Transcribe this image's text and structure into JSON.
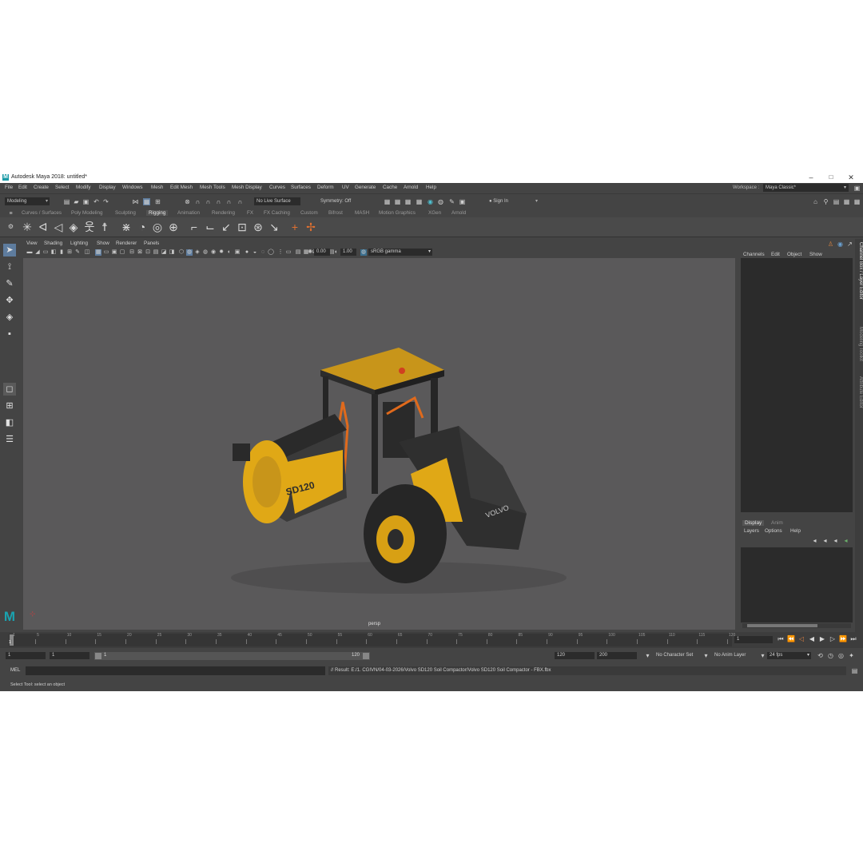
{
  "window": {
    "title": "Autodesk Maya 2018: untitled*",
    "logo": "M",
    "minimize": "–",
    "maximize": "□",
    "close": "✕"
  },
  "menubar": [
    "File",
    "Edit",
    "Create",
    "Select",
    "Modify",
    "Display",
    "Windows",
    "Mesh",
    "Edit Mesh",
    "Mesh Tools",
    "Mesh Display",
    "Curves",
    "Surfaces",
    "Deform",
    "UV",
    "Generate",
    "Cache",
    "Arnold",
    "Help"
  ],
  "workspace": {
    "label": "Workspace :",
    "value": "Maya Classic*"
  },
  "status_line": {
    "mode": "Modeling",
    "live_surface": "No Live Surface",
    "symmetry": "Symmetry: Off",
    "sign_in": "Sign In"
  },
  "shelf_tabs": [
    "Curves / Surfaces",
    "Poly Modeling",
    "Sculpting",
    "Rigging",
    "Animation",
    "Rendering",
    "FX",
    "FX Caching",
    "Custom",
    "Bifrost",
    "MASH",
    "Motion Graphics",
    "XGen",
    "Arnold"
  ],
  "active_shelf": "Rigging",
  "viewport": {
    "menu": [
      "View",
      "Shading",
      "Lighting",
      "Show",
      "Renderer",
      "Panels"
    ],
    "exposure": "0.00",
    "gamma": "1.00",
    "color_space": "sRGB gamma",
    "camera_label": "persp"
  },
  "model": {
    "brand": "VOLVO",
    "model_text": "SD120",
    "body_color": "#e0a816",
    "dark_color": "#2c2c2c",
    "accent_color": "#e06a1c"
  },
  "channel_box": {
    "menu": [
      "Channels",
      "Edit",
      "Object",
      "Show"
    ]
  },
  "layer_editor": {
    "tabs": [
      "Display",
      "Anim"
    ],
    "menu": [
      "Layers",
      "Options",
      "Help"
    ]
  },
  "side_tabs": [
    "Channel Box / Layer Editor",
    "Modeling Toolkit",
    "Attribute Editor"
  ],
  "timeline": {
    "ticks": [
      "1",
      "5",
      "10",
      "15",
      "20",
      "25",
      "30",
      "35",
      "40",
      "45",
      "50",
      "55",
      "60",
      "65",
      "70",
      "75",
      "80",
      "85",
      "90",
      "95",
      "100",
      "105",
      "110",
      "115",
      "120"
    ],
    "current_frame": "1"
  },
  "range": {
    "start": "1",
    "playback_start": "1",
    "slider_start": "1",
    "slider_end": "120",
    "playback_end": "120",
    "end": "200",
    "character_set": "No Character Set",
    "anim_layer": "No Anim Layer",
    "fps": "24 fps"
  },
  "command_line": {
    "lang": "MEL",
    "result": "// Result: E:/1. CGIVN/04-03-2026/Volvo SD120 Soil Compactor/Volvo SD120 Soil Compactor - FBX.fbx"
  },
  "help_line": "Select Tool: select an object"
}
